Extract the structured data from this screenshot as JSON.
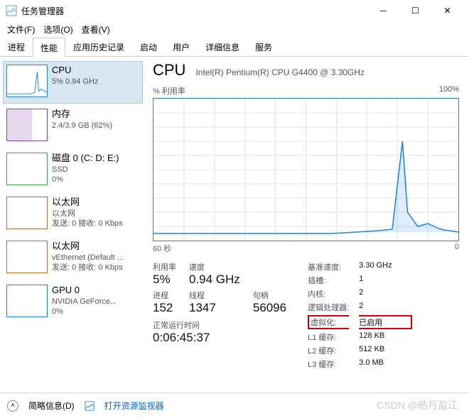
{
  "window": {
    "title": "任务管理器"
  },
  "menu": {
    "file": "文件(F)",
    "options": "选项(O)",
    "view": "查看(V)"
  },
  "tabs": [
    "进程",
    "性能",
    "应用历史记录",
    "启动",
    "用户",
    "详细信息",
    "服务"
  ],
  "sidebar": {
    "items": [
      {
        "title": "CPU",
        "sub": "5% 0.94 GHz"
      },
      {
        "title": "内存",
        "sub": "2.4/3.9 GB (62%)"
      },
      {
        "title": "磁盘 0 (C: D: E:)",
        "sub1": "SSD",
        "sub2": "0%"
      },
      {
        "title": "以太网",
        "sub1": "以太网",
        "sub2": "发送: 0 接收: 0 Kbps"
      },
      {
        "title": "以太网",
        "sub1": "vEthernet (Default ...",
        "sub2": "发送: 0 接收: 0 Kbps"
      },
      {
        "title": "GPU 0",
        "sub1": "NVIDIA GeForce...",
        "sub2": "0%"
      }
    ]
  },
  "main": {
    "title": "CPU",
    "subtitle": "Intel(R) Pentium(R) CPU G4400 @ 3.30GHz",
    "chart_top_left": "% 利用率",
    "chart_top_right": "100%",
    "chart_bottom_left": "60 秒",
    "chart_bottom_right": "0",
    "stats_left": {
      "util_label": "利用率",
      "util_value": "5%",
      "speed_label": "速度",
      "speed_value": "0.94 GHz",
      "proc_label": "进程",
      "proc_value": "152",
      "threads_label": "线程",
      "threads_value": "1347",
      "handles_label": "句柄",
      "handles_value": "56096"
    },
    "uptime": {
      "label": "正常运行时间",
      "value": "0:06:45:37"
    },
    "stats_right": [
      {
        "k": "基准速度:",
        "v": "3.30 GHz"
      },
      {
        "k": "插槽:",
        "v": "1"
      },
      {
        "k": "内核:",
        "v": "2"
      },
      {
        "k": "逻辑处理器:",
        "v": "2"
      },
      {
        "k": "虚拟化:",
        "v": "已启用",
        "highlight": true
      },
      {
        "k": "L1 缓存:",
        "v": "128 KB"
      },
      {
        "k": "L2 缓存:",
        "v": "512 KB"
      },
      {
        "k": "L3 缓存:",
        "v": "3.0 MB"
      }
    ]
  },
  "footer": {
    "fewer": "简略信息(D)",
    "resmon": "打开资源监视器"
  },
  "watermark": "CSDN @皓月盈江",
  "chart_data": {
    "type": "line",
    "title": "% 利用率",
    "xlim": [
      0,
      60
    ],
    "ylim": [
      0,
      100
    ],
    "xlabel": "60 秒",
    "ylabel": "% 利用率",
    "series": [
      {
        "name": "CPU 利用率",
        "x": [
          0,
          5,
          10,
          15,
          20,
          25,
          30,
          35,
          40,
          45,
          47,
          49,
          50,
          52,
          55,
          58,
          60
        ],
        "y": [
          5,
          4,
          6,
          5,
          4,
          5,
          6,
          5,
          5,
          6,
          8,
          70,
          20,
          10,
          12,
          8,
          6
        ]
      }
    ]
  }
}
